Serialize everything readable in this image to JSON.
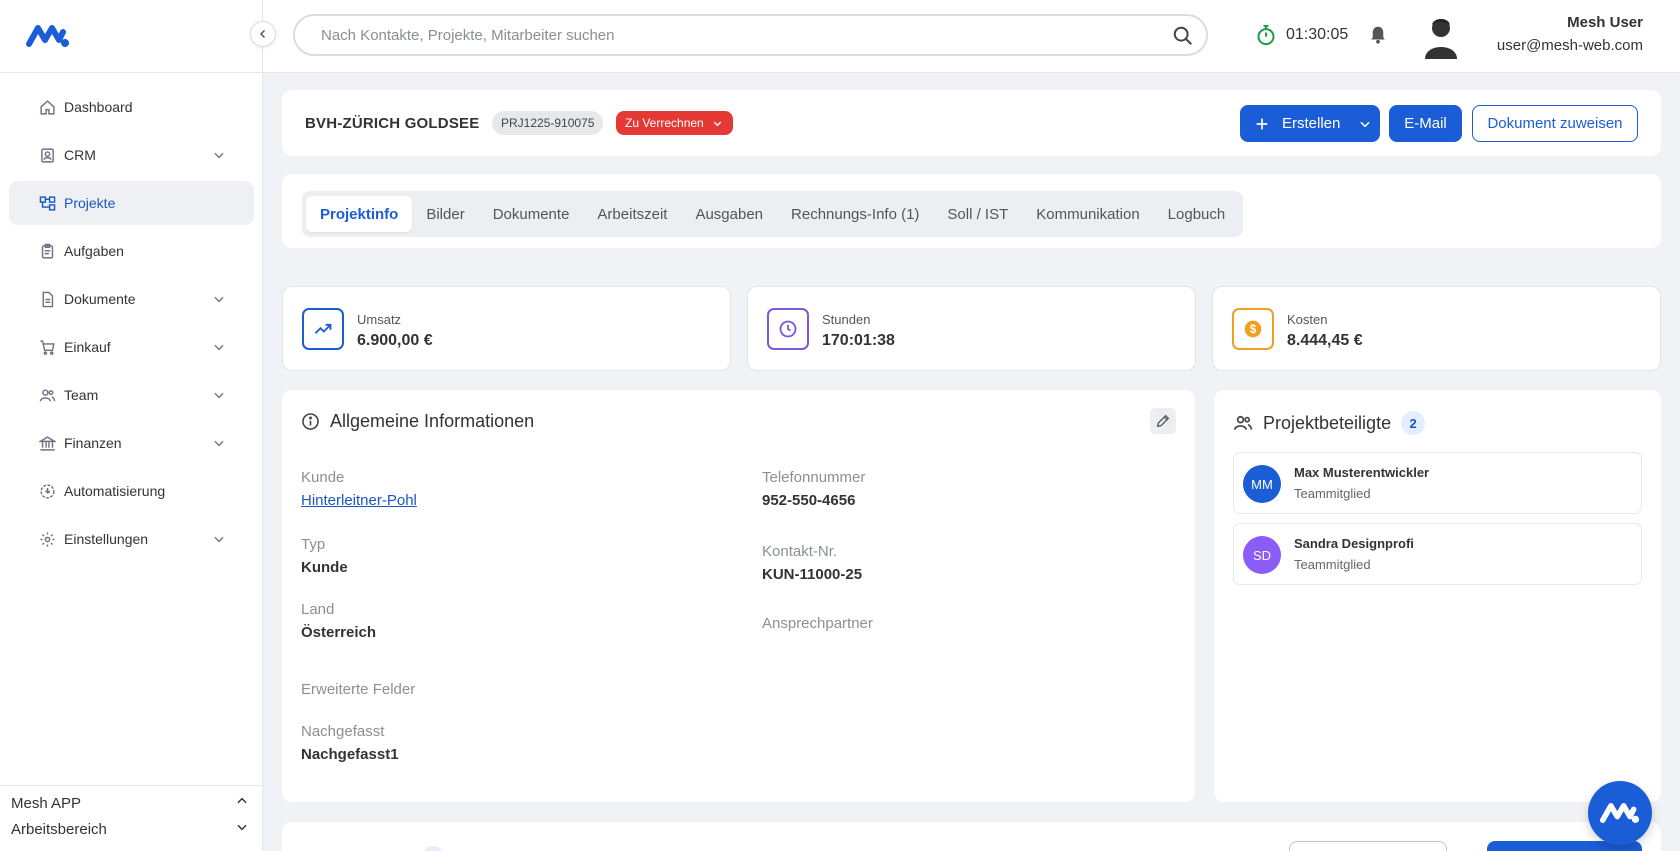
{
  "app": {
    "brand_color": "#1a5dd6"
  },
  "sidebar": {
    "items": [
      {
        "label": "Dashboard",
        "icon": "home-icon",
        "expandable": false,
        "active": false
      },
      {
        "label": "CRM",
        "icon": "contact-card-icon",
        "expandable": true,
        "active": false
      },
      {
        "label": "Projekte",
        "icon": "project-tree-icon",
        "expandable": false,
        "active": true
      },
      {
        "label": "Aufgaben",
        "icon": "clipboard-icon",
        "expandable": false,
        "active": false
      },
      {
        "label": "Dokumente",
        "icon": "document-icon",
        "expandable": true,
        "active": false
      },
      {
        "label": "Einkauf",
        "icon": "cart-icon",
        "expandable": true,
        "active": false
      },
      {
        "label": "Team",
        "icon": "users-icon",
        "expandable": true,
        "active": false
      },
      {
        "label": "Finanzen",
        "icon": "bank-icon",
        "expandable": true,
        "active": false
      },
      {
        "label": "Automatisierung",
        "icon": "automation-icon",
        "expandable": false,
        "active": false
      },
      {
        "label": "Einstellungen",
        "icon": "gear-icon",
        "expandable": true,
        "active": false
      }
    ],
    "footer": {
      "app_label": "Mesh APP",
      "workspace_label": "Arbeitsbereich"
    }
  },
  "topbar": {
    "search_placeholder": "Nach Kontakte, Projekte, Mitarbeiter suchen",
    "timer": "01:30:05",
    "user_name": "Mesh User",
    "user_email": "user@mesh-web.com"
  },
  "project": {
    "title": "BVH-ZÜRICH GOLDSEE",
    "code": "PRJ1225-910075",
    "status": "Zu Verrechnen",
    "status_color": "#e53935",
    "actions": {
      "create": "Erstellen",
      "email": "E-Mail",
      "assign_document": "Dokument zuweisen"
    }
  },
  "tabs": [
    {
      "label": "Projektinfo",
      "active": true
    },
    {
      "label": "Bilder",
      "active": false
    },
    {
      "label": "Dokumente",
      "active": false
    },
    {
      "label": "Arbeitszeit",
      "active": false
    },
    {
      "label": "Ausgaben",
      "active": false
    },
    {
      "label": "Rechnungs-Info (1)",
      "active": false
    },
    {
      "label": "Soll / IST",
      "active": false
    },
    {
      "label": "Kommunikation",
      "active": false
    },
    {
      "label": "Logbuch",
      "active": false
    }
  ],
  "stats": [
    {
      "label": "Umsatz",
      "value": "6.900,00 €",
      "icon": "trend-up-icon",
      "color": "#1a5dd6"
    },
    {
      "label": "Stunden",
      "value": "170:01:38",
      "icon": "clock-icon",
      "color": "#7b5cd6"
    },
    {
      "label": "Kosten",
      "value": "8.444,45 €",
      "icon": "dollar-coin-icon",
      "color": "#f0a020"
    }
  ],
  "general_info": {
    "title": "Allgemeine Informationen",
    "customer_label": "Kunde",
    "customer_value": "Hinterleitner-Pohl",
    "type_label": "Typ",
    "type_value": "Kunde",
    "country_label": "Land",
    "country_value": "Österreich",
    "extended_label": "Erweiterte Felder",
    "followup_label": "Nachgefasst",
    "followup_value": "Nachgefasst1",
    "phone_label": "Telefonnummer",
    "phone_value": "952-550-4656",
    "contact_no_label": "Kontakt-Nr.",
    "contact_no_value": "KUN-11000-25",
    "contact_person_label": "Ansprechpartner"
  },
  "participants": {
    "title": "Projektbeteiligte",
    "count": "2",
    "members": [
      {
        "initials": "MM",
        "name": "Max Musterentwickler",
        "role": "Teammitglied",
        "color": "#1a5dd6"
      },
      {
        "initials": "SD",
        "name": "Sandra Designprofi",
        "role": "Teammitglied",
        "color": "#8b5cf6"
      }
    ]
  }
}
